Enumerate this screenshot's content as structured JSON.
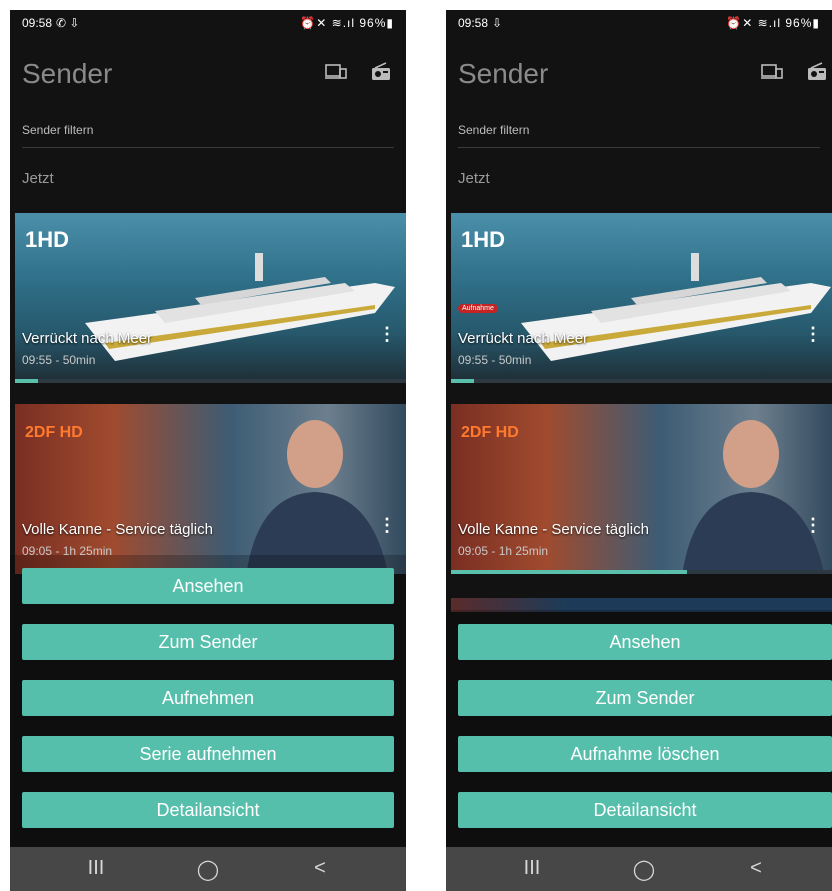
{
  "left": {
    "status": {
      "time": "09:58",
      "time_icons": "✆ ⇩",
      "right": "⏰✕ ≋.ıl 96%▮"
    },
    "title": "Sender",
    "filter_placeholder": "Sender filtern",
    "section": "Jetzt",
    "cards": [
      {
        "logo": "1HD",
        "title": "Verrückt nach Meer",
        "time": "09:55 - 50min",
        "progress": 0.06
      },
      {
        "logo": "2DF HD",
        "title": "Volle Kanne - Service täglich",
        "time": "09:05 - 1h 25min",
        "progress": 0.62
      }
    ],
    "buttons": [
      "Ansehen",
      "Zum Sender",
      "Aufnehmen",
      "Serie aufnehmen",
      "Detailansicht"
    ]
  },
  "right": {
    "status": {
      "time": "09:58",
      "time_icons": "⇩",
      "right": "⏰✕ ≋.ıl 96%▮"
    },
    "title": "Sender",
    "filter_placeholder": "Sender filtern",
    "section": "Jetzt",
    "cards": [
      {
        "logo": "1HD",
        "badge": "Aufnahme",
        "title": "Verrückt nach Meer",
        "time": "09:55 - 50min",
        "progress": 0.06
      },
      {
        "logo": "2DF HD",
        "title": "Volle Kanne - Service täglich",
        "time": "09:05 - 1h 25min",
        "progress": 0.62
      }
    ],
    "buttons": [
      "Ansehen",
      "Zum Sender",
      "Aufnahme löschen",
      "Detailansicht"
    ]
  },
  "nav": {
    "recents": "III",
    "home": "◯",
    "back": "<"
  },
  "colors": {
    "accent": "#56bfab",
    "background": "#121212",
    "navbar": "#474747",
    "recording_badge": "#c42424"
  }
}
